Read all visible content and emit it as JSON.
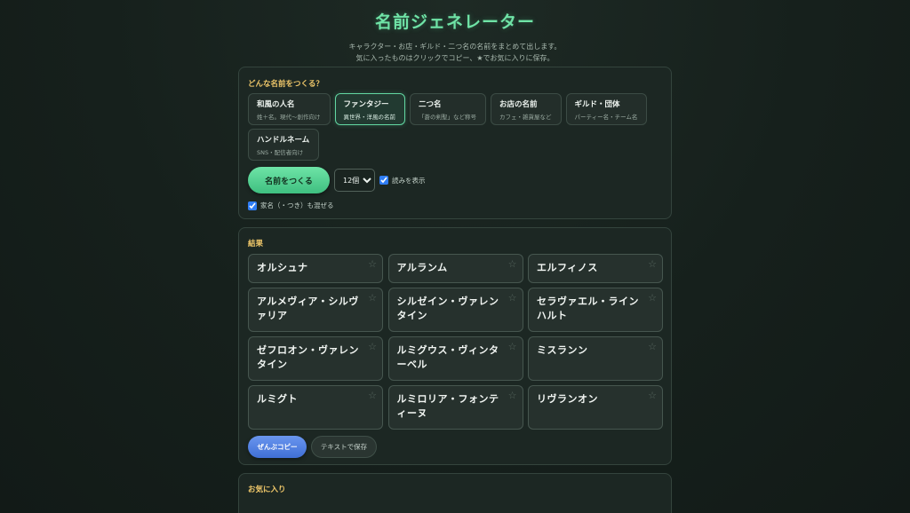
{
  "header": {
    "title": "名前ジェネレーター",
    "subtitle_line1": "キャラクター・お店・ギルド・二つ名の名前をまとめて出します。",
    "subtitle_line2": "気に入ったものはクリックでコピー、★でお気に入りに保存。"
  },
  "generator": {
    "section_title": "どんな名前をつくる？",
    "categories": [
      {
        "name": "和風の人名",
        "desc": "姓＋名。現代〜創作向け",
        "active": false
      },
      {
        "name": "ファンタジー",
        "desc": "異世界・洋風の名前",
        "active": true
      },
      {
        "name": "二つ名",
        "desc": "「蒼の剣聖」など称号",
        "active": false
      },
      {
        "name": "お店の名前",
        "desc": "カフェ・雑貨屋など",
        "active": false
      },
      {
        "name": "ギルド・団体",
        "desc": "パーティー名・チーム名",
        "active": false
      },
      {
        "name": "ハンドルネーム",
        "desc": "SNS・配信者向け",
        "active": false
      }
    ],
    "generate_label": "名前をつくる",
    "count_selected": "12個",
    "show_reading_label": "読みを表示",
    "show_reading_checked": true,
    "mix_family_label": "家名（・つき）も混ぜる",
    "mix_family_checked": true
  },
  "results": {
    "section_title": "結果",
    "star_icon": "☆",
    "names": [
      "オルシュナ",
      "アルランム",
      "エルフィノス",
      "アルメヴィア・シルヴァリア",
      "シルゼイン・ヴァレンタイン",
      "セラヴァエル・ラインハルト",
      "ゼフロオン・ヴァレンタイン",
      "ルミグウス・ヴィンターベル",
      "ミスランン",
      "ルミグト",
      "ルミロリア・フォンティーヌ",
      "リヴランオン"
    ],
    "copy_all_label": "ぜんぶコピー",
    "save_text_label": "テキストで保存"
  },
  "favorites": {
    "section_title": "お気に入り"
  },
  "colors": {
    "accent_green": "#6fe3a6",
    "section_title_gold": "#f0c86a",
    "copy_button_blue": "#3f6fd6"
  }
}
